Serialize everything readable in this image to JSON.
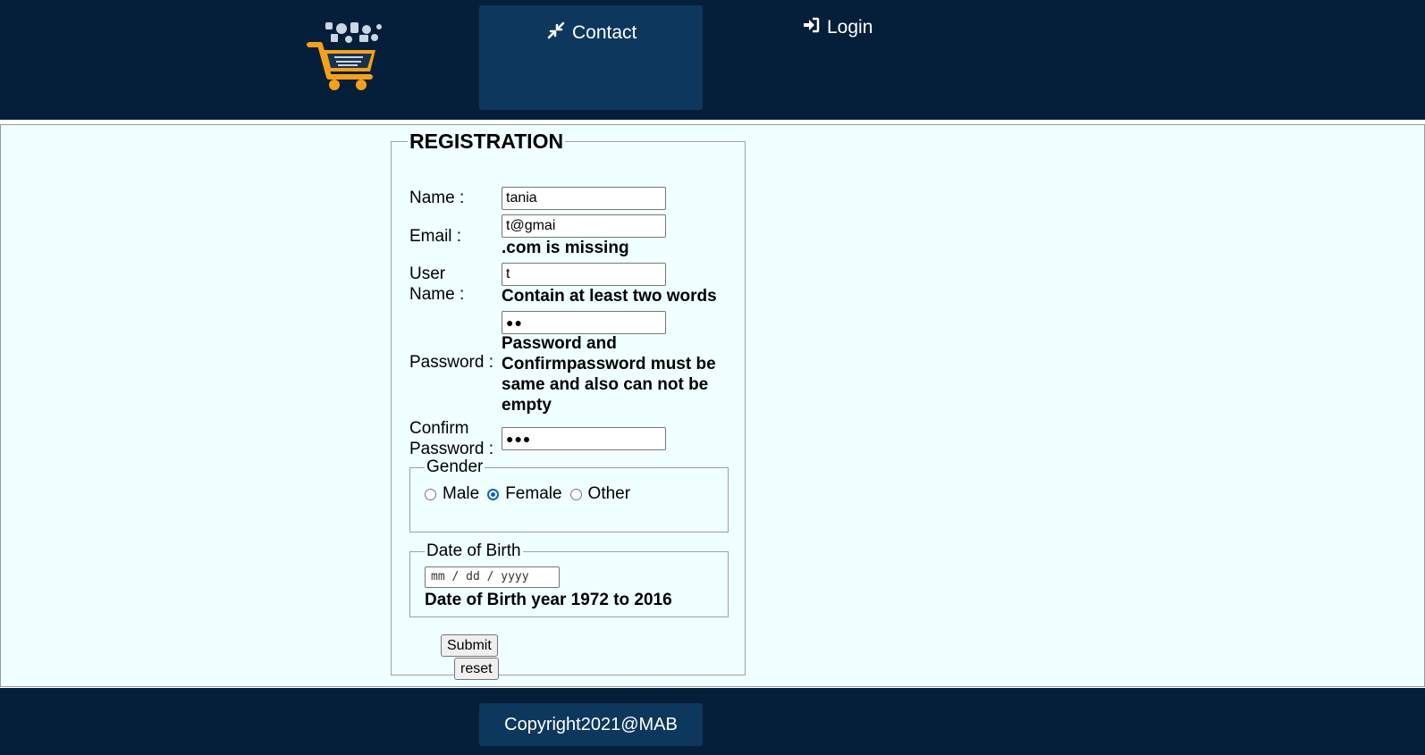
{
  "header": {
    "logo_icon": "shopping-cart-logo",
    "nav": {
      "contact_label": "Contact",
      "contact_icon": "compress-arrows-icon",
      "login_label": "Login",
      "login_icon": "sign-in-icon"
    }
  },
  "form": {
    "legend": "REGISTRATION",
    "name": {
      "label": "Name :",
      "value": "tania"
    },
    "email": {
      "label": "Email :",
      "value": "t@gmai",
      "error": ".com is missing"
    },
    "username": {
      "label_line1": "User",
      "label_line2": "Name :",
      "value": "t",
      "error": "Contain at least two words"
    },
    "password": {
      "label": "Password :",
      "masked": "●●",
      "error_lines": [
        "Password and",
        "Confirmpassword must be",
        "same and also can not be",
        "empty"
      ]
    },
    "confirm_password": {
      "label_line1": "Confirm",
      "label_line2": "Password :",
      "masked": "●●●"
    },
    "gender": {
      "legend": "Gender",
      "options": [
        "Male",
        "Female",
        "Other"
      ],
      "selected": "Female"
    },
    "dob": {
      "legend": "Date of Birth",
      "placeholder": "mm / dd / yyyy",
      "note": "Date of Birth year 1972 to 2016"
    },
    "submit_label": "Submit",
    "reset_label": "reset"
  },
  "footer": {
    "copyright": "Copyright2021@MAB"
  },
  "colors": {
    "header_bg": "#051f3a",
    "nav_active_bg": "#0e375e",
    "main_bg": "#f0ffff",
    "cart_orange": "#f5a11c",
    "radio_checked": "#0a63c7"
  }
}
